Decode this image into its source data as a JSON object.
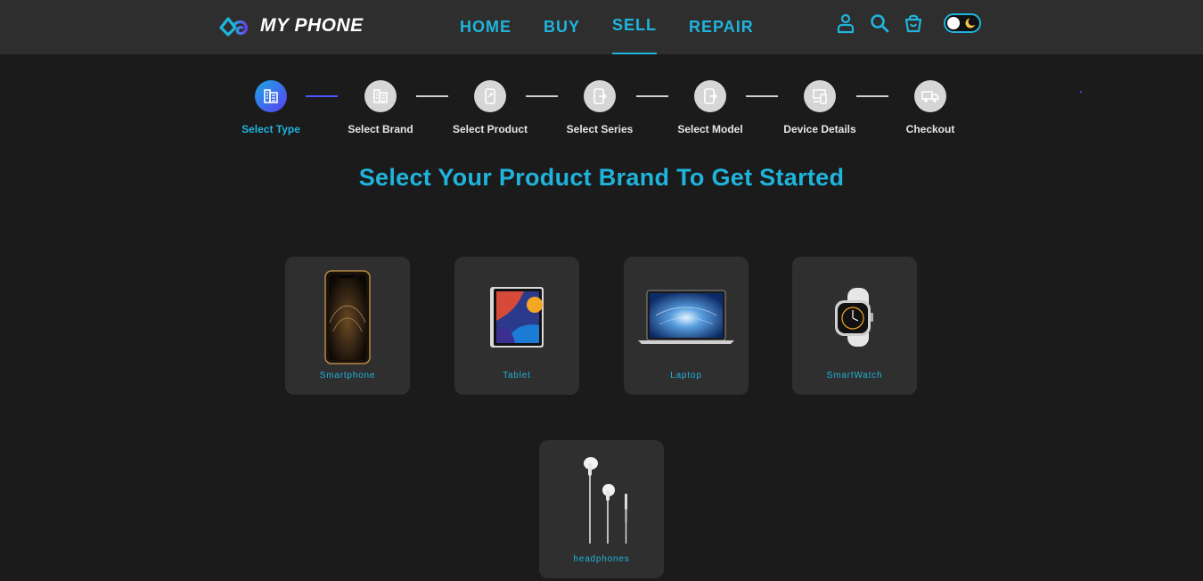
{
  "header": {
    "logo_text": "MY PHONE",
    "nav": [
      {
        "label": "HOME",
        "active": false
      },
      {
        "label": "BUY",
        "active": false
      },
      {
        "label": "SELL",
        "active": true
      },
      {
        "label": "REPAIR",
        "active": false
      }
    ],
    "icons": [
      "user-icon",
      "search-icon",
      "cart-icon"
    ],
    "theme_toggle": "dark-mode-toggle"
  },
  "steps": [
    {
      "label": "Select Type",
      "icon": "grid-icon",
      "active": true
    },
    {
      "label": "Select Brand",
      "icon": "grid-icon",
      "active": false
    },
    {
      "label": "Select Product",
      "icon": "phone-icon",
      "active": false
    },
    {
      "label": "Select Series",
      "icon": "phone-exit-icon",
      "active": false
    },
    {
      "label": "Select Model",
      "icon": "phone-exit-icon",
      "active": false
    },
    {
      "label": "Device Details",
      "icon": "devices-icon",
      "active": false
    },
    {
      "label": "Checkout",
      "icon": "truck-icon",
      "active": false
    }
  ],
  "heading": "Select Your Product Brand To Get Started",
  "products": [
    {
      "label": "Smartphone",
      "icon": "smartphone-image"
    },
    {
      "label": "Tablet",
      "icon": "tablet-image"
    },
    {
      "label": "Laptop",
      "icon": "laptop-image"
    },
    {
      "label": "SmartWatch",
      "icon": "smartwatch-image"
    },
    {
      "label": "headphones",
      "icon": "earphones-image"
    }
  ],
  "colors": {
    "accent": "#1fb4dc",
    "background": "#1b1b1b",
    "header": "#2e2e2e",
    "card": "#2f2f2f"
  }
}
